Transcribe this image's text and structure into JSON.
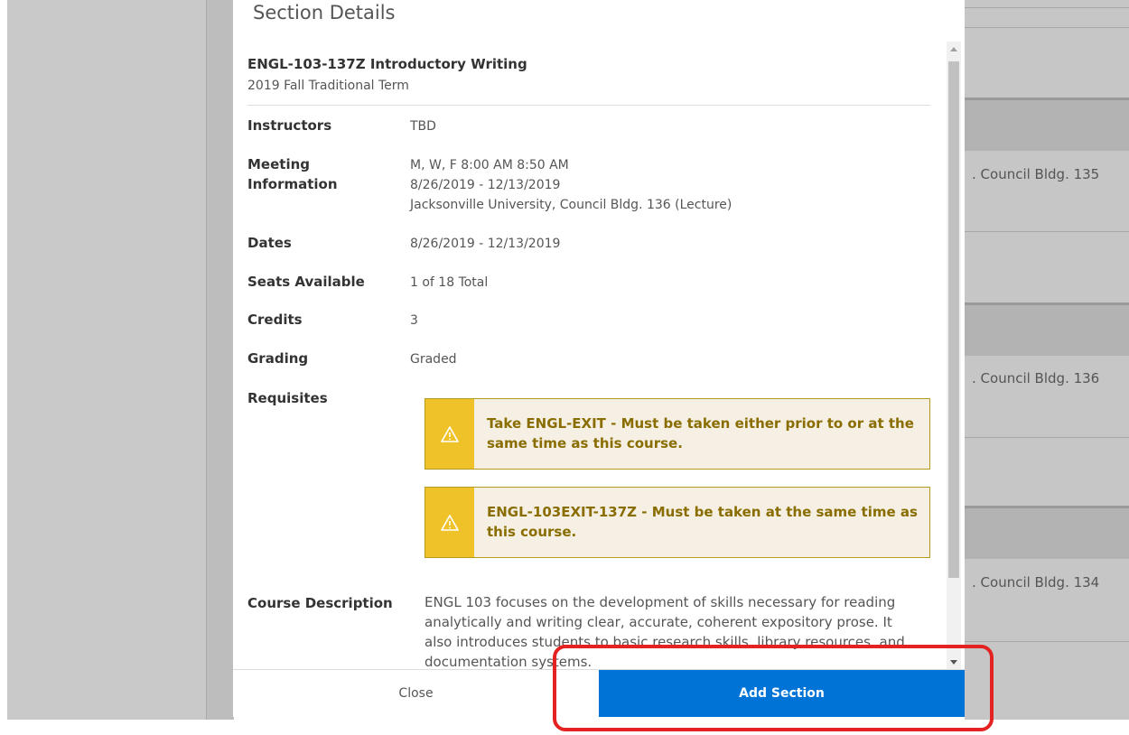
{
  "modal": {
    "title": "Section Details",
    "course_title": "ENGL-103-137Z Introductory Writing",
    "term": "2019 Fall Traditional Term",
    "rows": {
      "instructors": {
        "label": "Instructors",
        "value": "TBD"
      },
      "meeting": {
        "label_line1": "Meeting",
        "label_line2": "Information",
        "line1": "M, W, F 8:00 AM 8:50 AM",
        "line2": "8/26/2019 - 12/13/2019",
        "line3": "Jacksonville University, Council Bldg. 136 (Lecture)"
      },
      "dates": {
        "label": "Dates",
        "value": "8/26/2019 - 12/13/2019"
      },
      "seats": {
        "label": "Seats Available",
        "value": "1 of 18 Total"
      },
      "credits": {
        "label": "Credits",
        "value": "3"
      },
      "grading": {
        "label": "Grading",
        "value": "Graded"
      },
      "requisites": {
        "label": "Requisites",
        "items": [
          {
            "line1": "Take ENGL-EXIT - Must be taken either prior to or at the",
            "line2": "same time as this course."
          },
          {
            "line1": "ENGL-103EXIT-137Z - Must be taken at the same time as",
            "line2": "this course."
          }
        ]
      },
      "description": {
        "label": "Course Description",
        "line1": "ENGL 103 focuses on the development of skills necessary for reading",
        "line2": "analytically and writing clear, accurate, coherent expository prose. It",
        "line3": "also introduces students to basic research skills, library resources, and",
        "line4": "documentation systems."
      }
    },
    "buttons": {
      "close": "Close",
      "add": "Add Section"
    }
  },
  "background": {
    "locations": [
      "Council Bldg. 135",
      "Council Bldg. 136",
      "Council Bldg. 134"
    ]
  },
  "colors": {
    "primary_button": "#0073d7",
    "warning_icon_bg": "#efc22a",
    "warning_text": "#8a6d00",
    "highlight_border": "#e52222"
  }
}
